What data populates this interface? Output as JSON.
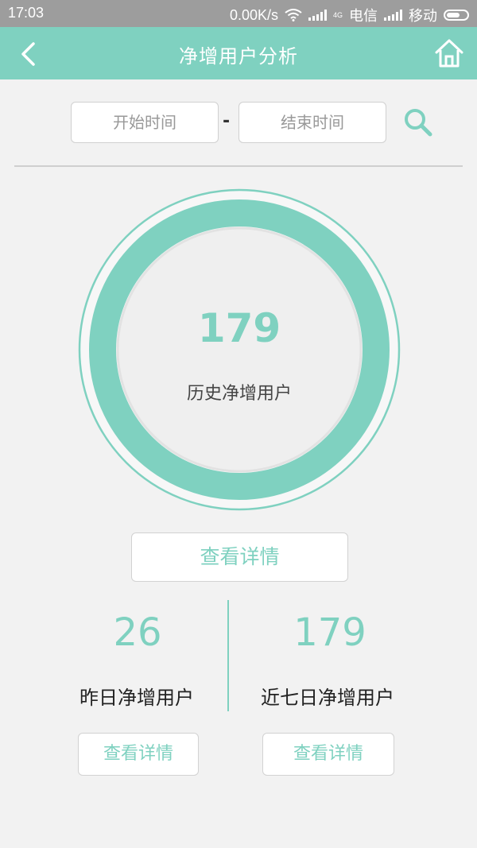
{
  "status_bar": {
    "time": "17:03",
    "speed": "0.00K/s",
    "carrier1": "电信",
    "carrier2": "移动",
    "network_badge": "4G"
  },
  "header": {
    "title": "净增用户分析",
    "back_icon": "chevron-left-icon",
    "home_icon": "home-icon",
    "color": "#7fd1c0"
  },
  "filter": {
    "start_placeholder": "开始时间",
    "separator": "-",
    "end_placeholder": "结束时间",
    "search_icon": "search-icon"
  },
  "summary": {
    "total_value": "179",
    "total_label": "历史净增用户",
    "detail_button": "查看详情"
  },
  "stats": [
    {
      "value": "26",
      "label": "昨日净增用户",
      "button": "查看详情"
    },
    {
      "value": "179",
      "label": "近七日净增用户",
      "button": "查看详情"
    }
  ],
  "colors": {
    "accent": "#7fd1c0",
    "background": "#f2f2f2"
  }
}
